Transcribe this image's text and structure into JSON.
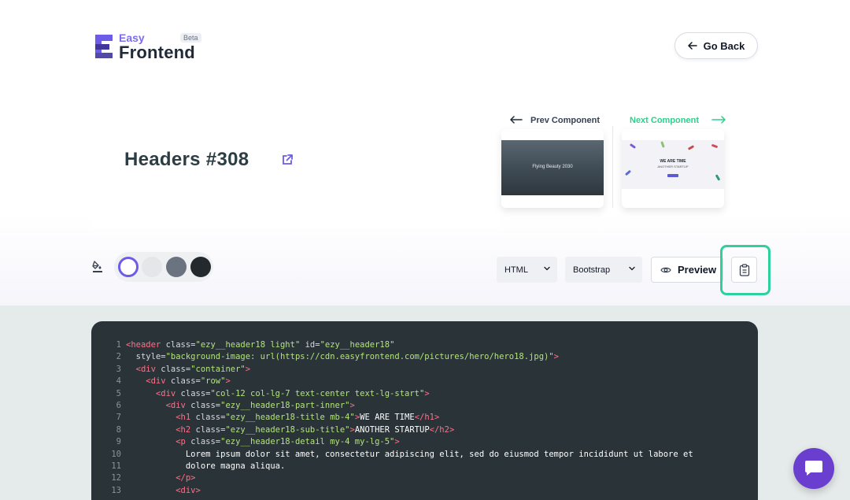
{
  "logo": {
    "easy": "Easy",
    "frontend": "Frontend",
    "badge": "Beta"
  },
  "header": {
    "go_back": "Go Back"
  },
  "component": {
    "title": "Headers #308"
  },
  "nav": {
    "prev_label": "Prev Component",
    "next_label": "Next Component",
    "prev_thumb_text": "Flying Beauty 2030",
    "next_thumb_title": "WE ARE TIME",
    "next_thumb_subtitle": "ANOTHER STARTUP"
  },
  "swatches": [
    "#ffffff",
    "#e4e6e9",
    "#6b7280",
    "#24292e"
  ],
  "accent": "#6c5ce7",
  "toolbar": {
    "language": "HTML",
    "framework": "Bootstrap",
    "preview": "Preview"
  },
  "code": [
    [
      [
        "tg",
        "<header "
      ],
      [
        "at",
        "class="
      ],
      [
        "st",
        "\"ezy__header18 light\" "
      ],
      [
        "at",
        "id="
      ],
      [
        "st",
        "\"ezy__header18\""
      ]
    ],
    [
      [
        "at",
        "  style="
      ],
      [
        "st",
        "\"background-image: url(https://cdn.easyfrontend.com/pictures/hero/hero18.jpg)\""
      ],
      [
        "tg",
        ">"
      ]
    ],
    [
      [
        "tg",
        "  <div "
      ],
      [
        "at",
        "class="
      ],
      [
        "st",
        "\"container\""
      ],
      [
        "tg",
        ">"
      ]
    ],
    [
      [
        "tg",
        "    <div "
      ],
      [
        "at",
        "class="
      ],
      [
        "st",
        "\"row\""
      ],
      [
        "tg",
        ">"
      ]
    ],
    [
      [
        "tg",
        "      <div "
      ],
      [
        "at",
        "class="
      ],
      [
        "st",
        "\"col-12 col-lg-7 text-center text-lg-start\""
      ],
      [
        "tg",
        ">"
      ]
    ],
    [
      [
        "tg",
        "        <div "
      ],
      [
        "at",
        "class="
      ],
      [
        "st",
        "\"ezy__header18-part-inner\""
      ],
      [
        "tg",
        ">"
      ]
    ],
    [
      [
        "tg",
        "          <h1 "
      ],
      [
        "at",
        "class="
      ],
      [
        "st",
        "\"ezy__header18-title mb-4\""
      ],
      [
        "tg",
        ">"
      ],
      [
        "tx",
        "WE ARE TIME"
      ],
      [
        "tg",
        "</h1>"
      ]
    ],
    [
      [
        "tg",
        "          <h2 "
      ],
      [
        "at",
        "class="
      ],
      [
        "st",
        "\"ezy__header18-sub-title\""
      ],
      [
        "tg",
        ">"
      ],
      [
        "tx",
        "ANOTHER STARTUP"
      ],
      [
        "tg",
        "</h2>"
      ]
    ],
    [
      [
        "tg",
        "          <p "
      ],
      [
        "at",
        "class="
      ],
      [
        "st",
        "\"ezy__header18-detail my-4 my-lg-5\""
      ],
      [
        "tg",
        ">"
      ]
    ],
    [
      [
        "tx",
        "            Lorem ipsum dolor sit amet, consectetur adipiscing elit, sed do eiusmod tempor incididunt ut labore et"
      ]
    ],
    [
      [
        "tx",
        "            dolore magna aliqua."
      ]
    ],
    [
      [
        "tg",
        "          </p>"
      ]
    ],
    [
      [
        "tg",
        "          <div>"
      ]
    ]
  ]
}
